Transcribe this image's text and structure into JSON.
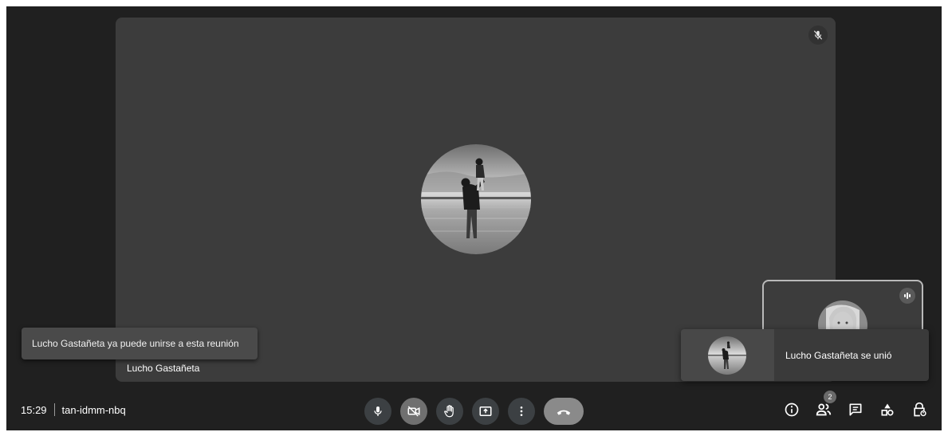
{
  "main_tile": {
    "participant_name": "Lucho Gastañeta",
    "mic_status_icon": "mic-off-icon"
  },
  "notification": {
    "text": "Lucho Gastañeta ya puede unirse a esta reunión"
  },
  "self_view": {
    "status_icon": "speaking-indicator-icon"
  },
  "join_toast": {
    "text": "Lucho Gastañeta se unió"
  },
  "bottom_bar": {
    "time": "15:29",
    "meeting_code": "tan-idmm-nbq",
    "controls": [
      {
        "name": "microphone",
        "icon": "mic-icon"
      },
      {
        "name": "camera",
        "icon": "camera-off-icon"
      },
      {
        "name": "raise-hand",
        "icon": "hand-icon"
      },
      {
        "name": "present",
        "icon": "present-screen-icon"
      },
      {
        "name": "more-options",
        "icon": "more-vert-icon"
      },
      {
        "name": "leave-call",
        "icon": "call-end-icon"
      }
    ],
    "right_controls": [
      {
        "name": "meeting-details",
        "icon": "info-icon"
      },
      {
        "name": "people",
        "icon": "people-icon",
        "badge": "2"
      },
      {
        "name": "chat",
        "icon": "chat-icon"
      },
      {
        "name": "activities",
        "icon": "shapes-icon"
      },
      {
        "name": "host-controls",
        "icon": "lock-person-icon"
      }
    ]
  }
}
